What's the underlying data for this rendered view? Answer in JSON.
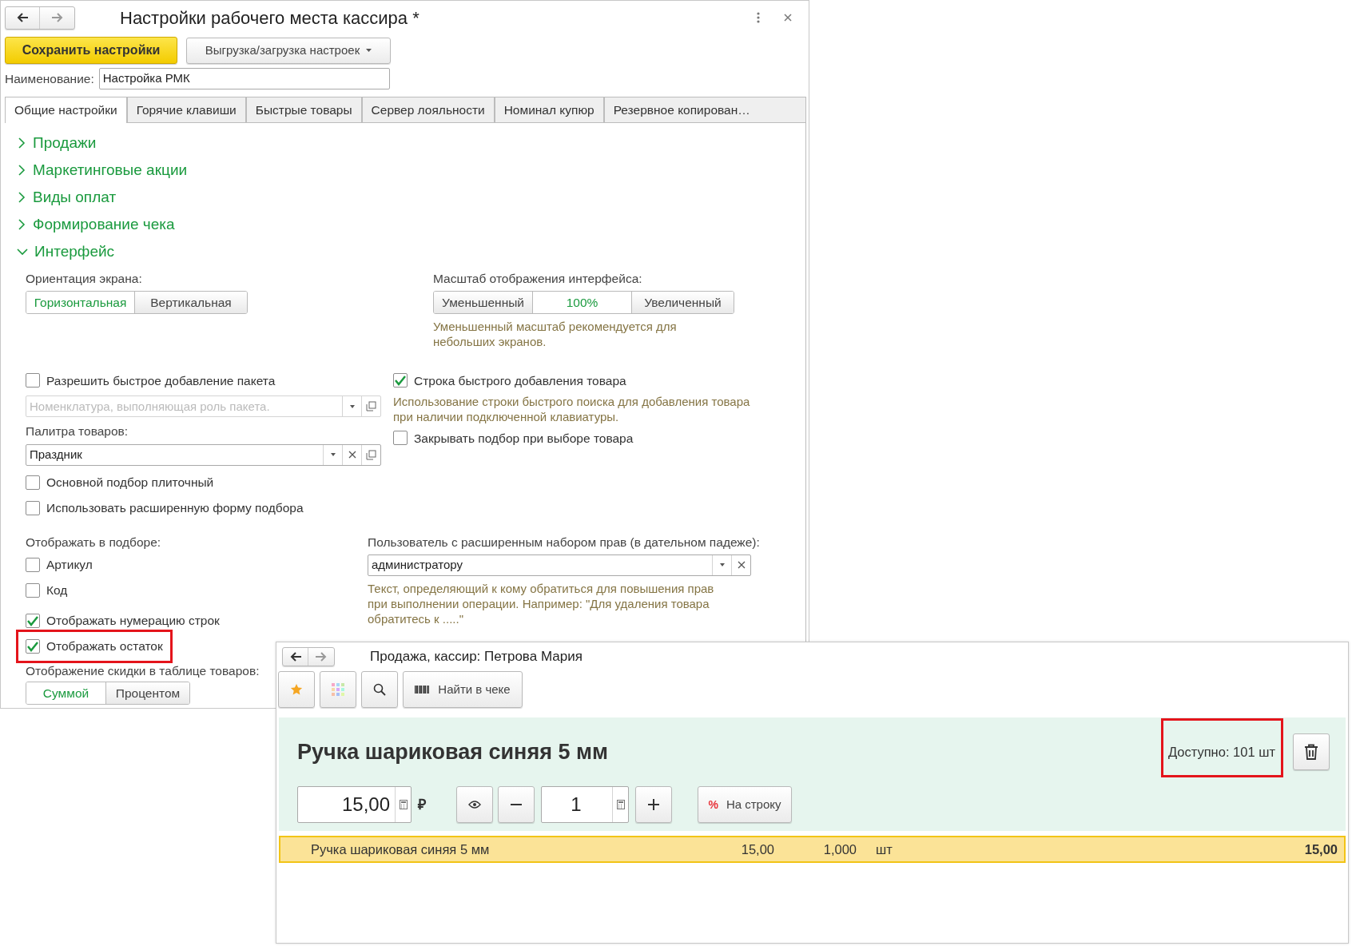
{
  "settings_window": {
    "title": "Настройки рабочего места кассира *",
    "save_button": "Сохранить настройки",
    "export_button": "Выгрузка/загрузка настроек",
    "name_field": {
      "label": "Наименование:",
      "value": "Настройка РМК"
    },
    "tabs": [
      {
        "label": "Общие настройки",
        "selected": true
      },
      {
        "label": "Горячие клавиши",
        "selected": false
      },
      {
        "label": "Быстрые товары",
        "selected": false
      },
      {
        "label": "Сервер лояльности",
        "selected": false
      },
      {
        "label": "Номинал купюр",
        "selected": false
      },
      {
        "label": "Резервное копирован…",
        "selected": false
      }
    ],
    "sections": [
      {
        "title": "Продажи",
        "expanded": false
      },
      {
        "title": "Маркетинговые акции",
        "expanded": false
      },
      {
        "title": "Виды оплат",
        "expanded": false
      },
      {
        "title": "Формирование чека",
        "expanded": false
      },
      {
        "title": "Интерфейс",
        "expanded": true
      }
    ],
    "interface": {
      "orientation": {
        "label": "Ориентация экрана:",
        "options": [
          {
            "label": "Горизонтальная",
            "selected": true
          },
          {
            "label": "Вертикальная",
            "selected": false
          }
        ]
      },
      "scale": {
        "label": "Масштаб отображения интерфейса:",
        "options": [
          {
            "label": "Уменьшенный",
            "selected": false
          },
          {
            "label": "100%",
            "selected": true
          },
          {
            "label": "Увеличенный",
            "selected": false
          }
        ],
        "hint": "Уменьшенный масштаб рекомендуется для небольших экранов."
      },
      "block_1_left": [
        {
          "kind": "checkbox",
          "label": "Разрешить быстрое добавление пакета",
          "checked": false
        },
        {
          "kind": "field",
          "placeholder": "Номенклатура, выполняющая роль пакета.",
          "disabled": true,
          "clear_button": false,
          "open_button": true
        },
        {
          "kind": "label",
          "text": "Палитра товаров:"
        },
        {
          "kind": "field",
          "value": "Праздник",
          "disabled": false,
          "clear_button": true,
          "open_button": true
        },
        {
          "kind": "checkbox",
          "label": "Основной подбор плиточный",
          "checked": false
        },
        {
          "kind": "checkbox",
          "label": "Использовать расширенную форму подбора",
          "checked": false
        }
      ],
      "block_1_right": [
        {
          "kind": "checkbox",
          "label": "Строка быстрого добавления товара",
          "checked": true
        },
        {
          "kind": "hint",
          "text": "Использование строки быстрого поиска для добавления товара при наличии подключенной клавиатуры."
        },
        {
          "kind": "checkbox",
          "label": "Закрывать подбор при выборе товара",
          "checked": false
        }
      ],
      "block_2_left": [
        {
          "kind": "label",
          "text": "Отображать в подборе:"
        },
        {
          "kind": "checkbox",
          "label": "Артикул",
          "checked": false
        },
        {
          "kind": "checkbox",
          "label": "Код",
          "checked": false
        },
        {
          "kind": "checkbox",
          "label": "Отображать нумерацию строк",
          "checked": true
        },
        {
          "kind": "checkbox",
          "label": "Отображать остаток",
          "checked": true,
          "highlighted": true
        },
        {
          "kind": "label",
          "text": "Отображение скидки в таблице товаров:"
        },
        {
          "kind": "segmented",
          "options": [
            {
              "label": "Суммой",
              "selected": true
            },
            {
              "label": "Процентом",
              "selected": false
            }
          ]
        }
      ],
      "block_2_right": [
        {
          "kind": "label",
          "text": "Пользователь с расширенным набором прав (в дательном падеже):"
        },
        {
          "kind": "field",
          "value": "администратору",
          "disabled": false,
          "clear_button": true,
          "open_button": false
        },
        {
          "kind": "hint",
          "text": "Текст, определяющий к кому обратиться для повышения прав при выполнении операции. Например: \"Для удаления товара обратитесь к .....\""
        }
      ]
    }
  },
  "sale_window": {
    "title": "Продажа, кассир: Петрова Мария",
    "find_button": "Найти в чеке",
    "product": {
      "name": "Ручка шариковая синяя 5 мм",
      "available": {
        "text": "Доступно: 101 шт",
        "highlighted": true
      },
      "price": "15,00",
      "currency": "₽",
      "quantity": "1",
      "discount_sign": "%",
      "line_discount_button": "На строку"
    },
    "rows": [
      {
        "name": "Ручка шариковая синяя 5 мм",
        "price": "15,00",
        "quantity": "1,000",
        "unit": "шт",
        "total": "15,00",
        "selected": true
      }
    ]
  }
}
